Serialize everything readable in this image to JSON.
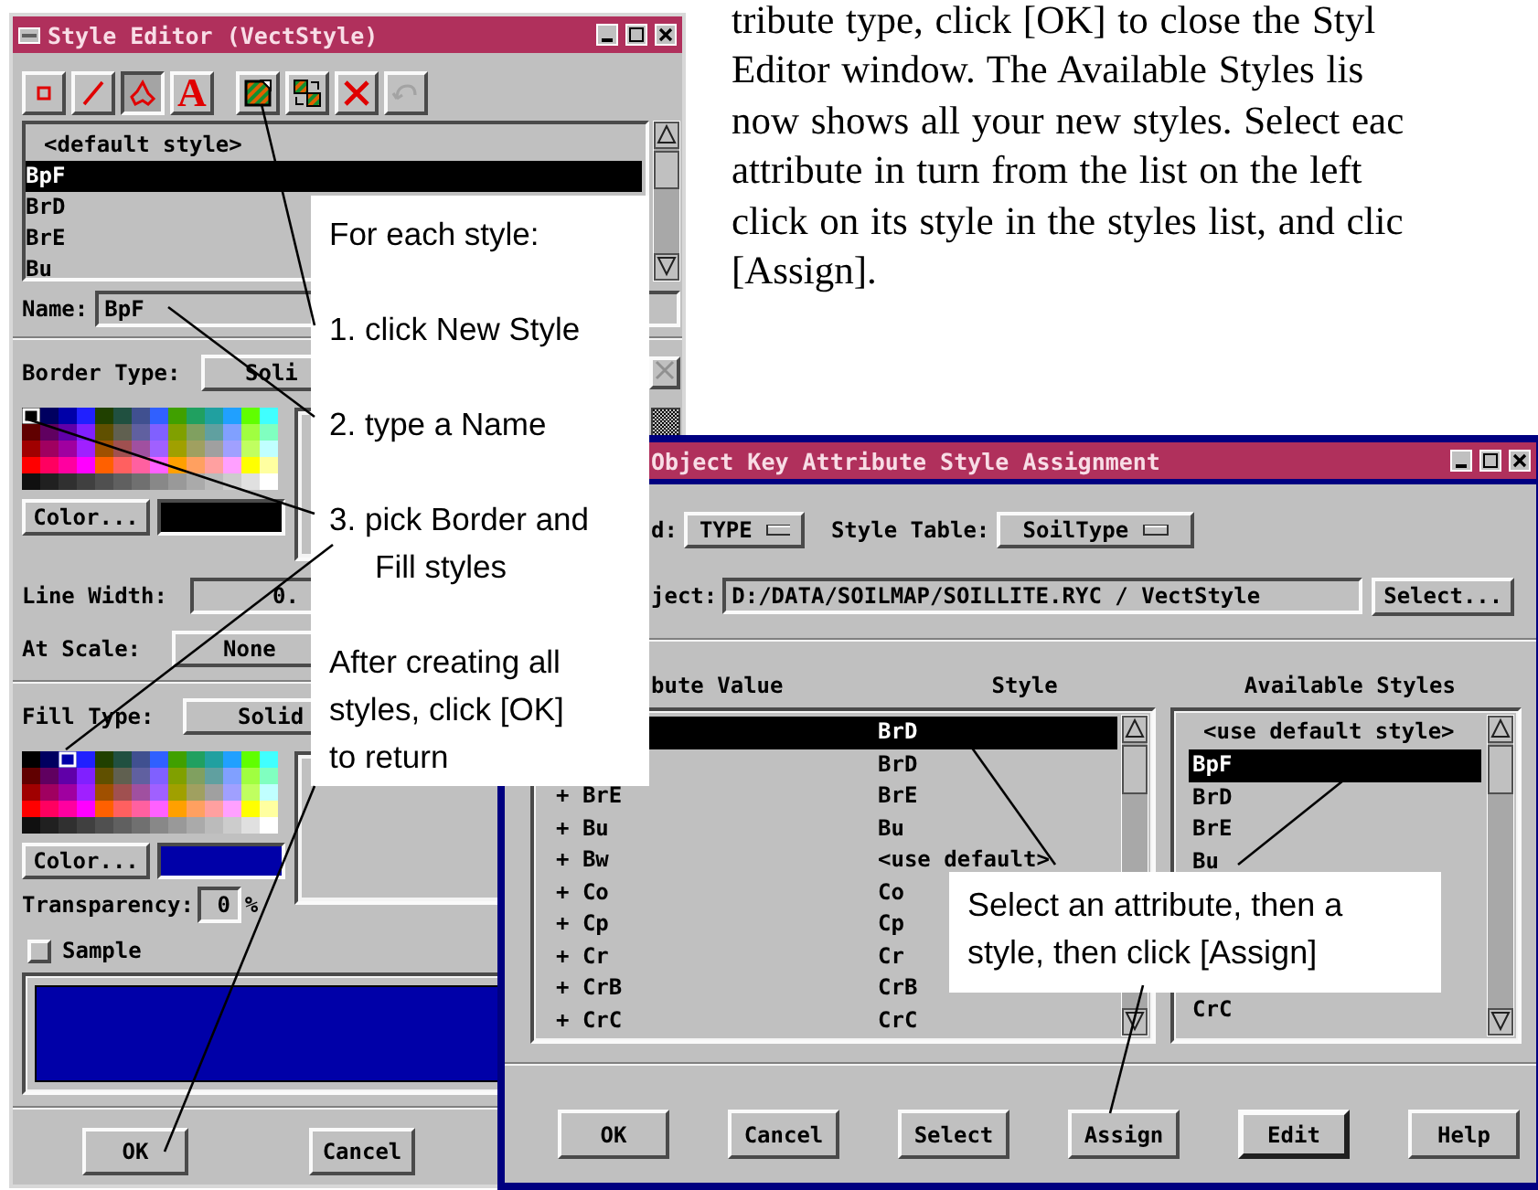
{
  "style_editor": {
    "title": "Style Editor (VectStyle)",
    "toolbar": [
      {
        "kind": "point",
        "selected": false,
        "disabled": false
      },
      {
        "kind": "line",
        "selected": false,
        "disabled": false
      },
      {
        "kind": "polygon",
        "selected": true,
        "disabled": false
      },
      {
        "kind": "text",
        "label": "A",
        "selected": false,
        "disabled": false
      },
      {
        "kind": "new_style",
        "selected": false,
        "disabled": false
      },
      {
        "kind": "copy_style",
        "selected": false,
        "disabled": false
      },
      {
        "kind": "delete_style",
        "selected": false,
        "disabled": false
      },
      {
        "kind": "undo",
        "selected": false,
        "disabled": true
      }
    ],
    "styles": [
      {
        "kind": "default",
        "label": "<default style>",
        "selected": false
      },
      {
        "kind": "style",
        "label": "BpF",
        "selected": true
      },
      {
        "kind": "style",
        "label": "BrD",
        "selected": false
      },
      {
        "kind": "style",
        "label": "BrE",
        "selected": false
      },
      {
        "kind": "style",
        "label": "Bu",
        "selected": false
      }
    ],
    "name": {
      "label": "Name:",
      "value": "BpF"
    },
    "border_type": {
      "label": "Border Type:",
      "value": "Soli"
    },
    "border_color": {
      "button": "Color...",
      "color": "#000000"
    },
    "line_width": {
      "label": "Line Width:",
      "value": "0."
    },
    "at_scale": {
      "label": "At Scale:",
      "value": "None"
    },
    "fill_type": {
      "label": "Fill Type:",
      "value": "Solid"
    },
    "fill_color": {
      "button": "Color...",
      "color": "#0000a8"
    },
    "transparency": {
      "label": "Transparency:",
      "value": "0",
      "unit": "%"
    },
    "sample": {
      "label": "Sample",
      "checked": false
    },
    "buttons": [
      "OK",
      "Cancel"
    ]
  },
  "paragraph": [
    "tribute type, click [OK] to close the Styl",
    "Editor window.  The Available Styles lis",
    "now shows all your new styles.  Select eac",
    "attribute in turn from the list on the left",
    "click on its style in the styles list, and clic",
    "[Assign]."
  ],
  "assignment_window": {
    "title": "Object Key Attribute Style Assignment",
    "field": {
      "label": "d:",
      "value": "TYPE"
    },
    "style_table": {
      "label": "Style Table:",
      "value": "SoilType"
    },
    "object": {
      "label": "ject:",
      "value": "D:/DATA/SOILMAP/SOILLITE.RYC / VectStyle",
      "button": "Select..."
    },
    "columns": [
      "bute Value",
      "Style"
    ],
    "rows": [
      {
        "style": "BrD",
        "selected": true
      },
      {
        "style": "BrD",
        "selected": false
      },
      {
        "attribute": "+ BrE",
        "style": "BrE",
        "selected": false
      },
      {
        "attribute": "+ Bu",
        "style": "Bu",
        "selected": false
      },
      {
        "attribute": "+ Bw",
        "style": "<use default>",
        "selected": false
      },
      {
        "attribute": "+ Co",
        "style": "Co",
        "selected": false
      },
      {
        "attribute": "+ Cp",
        "style": "Cp",
        "selected": false
      },
      {
        "attribute": "+ Cr",
        "style": "Cr",
        "selected": false
      },
      {
        "attribute": "+ CrB",
        "style": "CrB",
        "selected": false
      },
      {
        "attribute": "+ CrC",
        "style": "CrC",
        "selected": false
      }
    ],
    "available_header": "Available Styles",
    "available": [
      {
        "label": "<use default style>",
        "selected": false
      },
      {
        "label": "BpF",
        "selected": true
      },
      {
        "label": "BrD",
        "selected": false
      },
      {
        "label": "BrE",
        "selected": false
      },
      {
        "label": "Bu",
        "selected": false
      },
      {
        "label": "CrC",
        "selected": false
      }
    ],
    "buttons": [
      {
        "label": "OK",
        "default": false
      },
      {
        "label": "Cancel",
        "default": false
      },
      {
        "label": "Select",
        "default": false
      },
      {
        "label": "Assign",
        "default": false
      },
      {
        "label": "Edit",
        "default": true
      },
      {
        "label": "Help",
        "default": false
      }
    ]
  },
  "callout_left": {
    "heading": "For each style:",
    "steps": [
      "1. click New Style",
      "2. type a Name",
      "3. pick Border and Fill styles"
    ],
    "note_lines": [
      "After creating all",
      "styles, click [OK]",
      "to return"
    ]
  },
  "callout_right": {
    "lines": [
      "Select an attribute, then a",
      "style, then click [Assign]"
    ]
  }
}
